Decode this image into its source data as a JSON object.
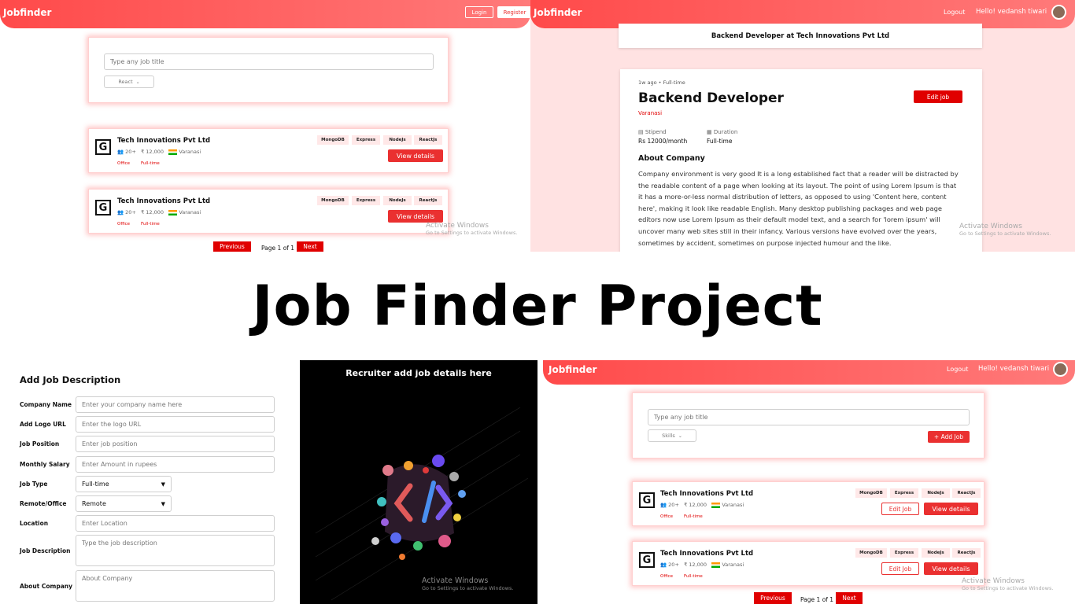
{
  "main_title": "Job Finder Project",
  "brand": "Jobfinder",
  "panel_tl": {
    "login": "Login",
    "register": "Register",
    "search_placeholder": "Type any job title",
    "filter": "React",
    "jobs": [
      {
        "company": "Tech Innovations Pvt Ltd",
        "size": "20+",
        "salary": "₹ 12,000",
        "location": "Varanasi",
        "type1": "Office",
        "type2": "Full-time",
        "skills": [
          "MongoDB",
          "Express",
          "NodeJs",
          "ReactJs"
        ],
        "view": "View details"
      },
      {
        "company": "Tech Innovations Pvt Ltd",
        "size": "20+",
        "salary": "₹ 12,000",
        "location": "Varanasi",
        "type1": "Office",
        "type2": "Full-time",
        "skills": [
          "MongoDB",
          "Express",
          "NodeJs",
          "ReactJs"
        ],
        "view": "View details"
      }
    ],
    "prev": "Previous",
    "page": "Page 1 of 1",
    "next": "Next",
    "watermark1": "Activate Windows",
    "watermark2": "Go to Settings to activate Windows."
  },
  "panel_tr": {
    "logout": "Logout",
    "greeting": "Hello! vedansh tiwari",
    "banner": "Backend Developer at Tech Innovations Pvt Ltd",
    "posted": "1w ago",
    "jobtype": "Full-time",
    "position": "Backend Developer",
    "edit": "Edit job",
    "location": "Varanasi",
    "stipend_label": "Stipend",
    "stipend": "Rs 12000/month",
    "duration_label": "Duration",
    "duration": "Full-time",
    "about_heading": "About Company",
    "about_text": "Company environment is very good It is a long established fact that a reader will be distracted by the readable content of a page when looking at its layout. The point of using Lorem Ipsum is that it has a more-or-less normal distribution of letters, as opposed to using 'Content here, content here', making it look like readable English. Many desktop publishing packages and web page editors now use Lorem Ipsum as their default model text, and a search for 'lorem ipsum' will uncover many web sites still in their infancy. Various versions have evolved over the years, sometimes by accident, sometimes on purpose injected humour and the like.",
    "watermark1": "Activate Windows",
    "watermark2": "Go to Settings to activate Windows."
  },
  "panel_bl": {
    "heading": "Add Job Description",
    "fields": [
      {
        "label": "Company Name",
        "placeholder": "Enter your company name here"
      },
      {
        "label": "Add Logo URL",
        "placeholder": "Enter the logo URL"
      },
      {
        "label": "Job Position",
        "placeholder": "Enter job position"
      },
      {
        "label": "Monthly Salary",
        "placeholder": "Enter Amount in rupees"
      }
    ],
    "jobtype_label": "Job Type",
    "jobtype_value": "Full-time",
    "remote_label": "Remote/Office",
    "remote_value": "Remote",
    "location_label": "Location",
    "location_placeholder": "Enter Location",
    "desc_label": "Job Description",
    "desc_placeholder": "Type the job description",
    "about_label": "About Company",
    "about_placeholder": "About Company"
  },
  "panel_bm": {
    "title": "Recruiter add job details here",
    "watermark1": "Activate Windows",
    "watermark2": "Go to Settings to activate Windows."
  },
  "panel_br": {
    "logout": "Logout",
    "greeting": "Hello! vedansh tiwari",
    "search_placeholder": "Type any job title",
    "filter": "Skills",
    "add": "+ Add Job",
    "jobs": [
      {
        "company": "Tech Innovations Pvt Ltd",
        "size": "20+",
        "salary": "₹ 12,000",
        "location": "Varanasi",
        "type1": "Office",
        "type2": "Full-time",
        "skills": [
          "MongoDB",
          "Express",
          "NodeJs",
          "ReactJs"
        ],
        "edit": "Edit Job",
        "view": "View details"
      },
      {
        "company": "Tech Innovations Pvt Ltd",
        "size": "20+",
        "salary": "₹ 12,000",
        "location": "Varanasi",
        "type1": "Office",
        "type2": "Full-time",
        "skills": [
          "MongoDB",
          "Express",
          "NodeJs",
          "ReactJs"
        ],
        "edit": "Edit Job",
        "view": "View details"
      }
    ],
    "prev": "Previous",
    "page": "Page 1 of 1",
    "next": "Next",
    "watermark1": "Activate Windows",
    "watermark2": "Go to Settings to activate Windows."
  }
}
